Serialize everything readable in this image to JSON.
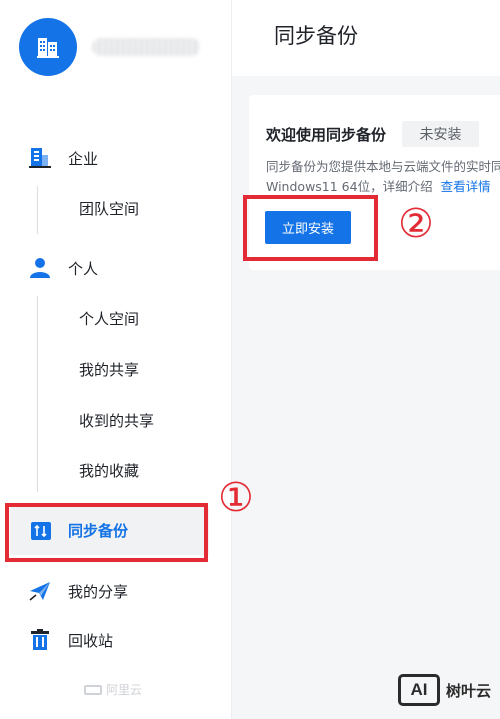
{
  "header": {
    "title": "同步备份"
  },
  "sidebar": {
    "sections": {
      "enterprise": {
        "label": "企业",
        "items": [
          "团队空间"
        ]
      },
      "personal": {
        "label": "个人",
        "items": [
          "个人空间",
          "我的共享",
          "收到的共享",
          "我的收藏"
        ]
      }
    },
    "sync_backup": {
      "label": "同步备份"
    },
    "my_shares": {
      "label": "我的分享"
    },
    "recycle_bin": {
      "label": "回收站"
    },
    "footer_logo": "阿里云"
  },
  "card": {
    "title": "欢迎使用同步备份",
    "status_badge": "未安装",
    "description_line1": "同步备份为您提供本地与云端文件的实时同",
    "description_line2": "Windows11 64位，详细介绍",
    "details_link": "查看详情",
    "install_button": "立即安装"
  },
  "annotations": {
    "marker1": "①",
    "marker2": "②"
  },
  "watermark": {
    "logo": "AI",
    "text": "树叶云"
  },
  "colors": {
    "accent": "#1473e6",
    "highlight": "#e32b35"
  }
}
